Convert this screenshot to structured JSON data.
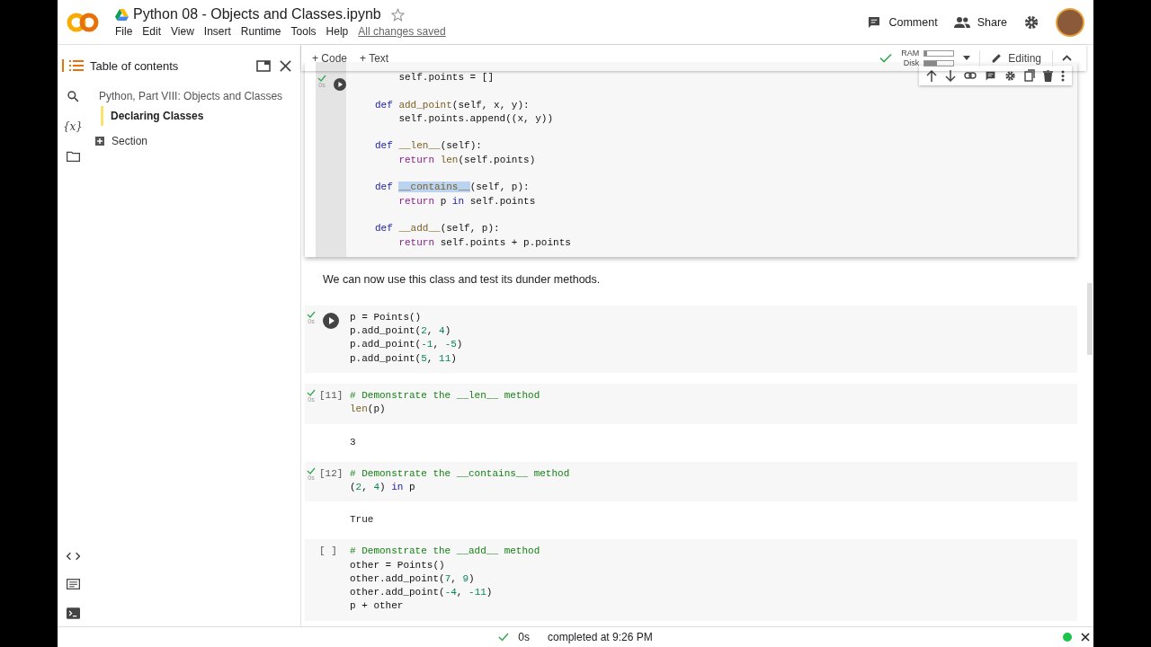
{
  "header": {
    "title": "Python 08 - Objects and Classes.ipynb",
    "menu": [
      "File",
      "Edit",
      "View",
      "Insert",
      "Runtime",
      "Tools",
      "Help"
    ],
    "save_status": "All changes saved",
    "comment": "Comment",
    "share": "Share"
  },
  "toolbar": {
    "add_code": "+ Code",
    "add_text": "+ Text",
    "connected": true,
    "resources": [
      {
        "label": "RAM",
        "level": 0.08
      },
      {
        "label": "Disk",
        "level": 0.42
      }
    ],
    "mode": "Editing"
  },
  "sidebar": {
    "rail_text": "{x}",
    "title": "Table of contents",
    "toc": [
      {
        "label": "Python, Part VIII: Objects and Classes",
        "selected": false,
        "children": [
          {
            "label": "Declaring Classes",
            "selected": true
          }
        ]
      }
    ],
    "add_section": "Section"
  },
  "cells": [
    {
      "kind": "code",
      "run_button": true,
      "done": true,
      "time": "0s",
      "focused": true,
      "lines": [
        {
          "kind": "code",
          "tokens": [
            {
              "text": "    self.points = []",
              "kind": "plain"
            }
          ]
        },
        {
          "kind": "blank"
        },
        {
          "kind": "code",
          "tokens": [
            {
              "text": "def ",
              "kind": "kw"
            },
            {
              "text": "add_point",
              "kind": "fn"
            },
            {
              "text": "(self, x, y):",
              "kind": "plain"
            }
          ]
        },
        {
          "kind": "code",
          "tokens": [
            {
              "text": "    self.points.append((x, y))",
              "kind": "plain"
            }
          ]
        },
        {
          "kind": "blank"
        },
        {
          "kind": "code",
          "tokens": [
            {
              "text": "def ",
              "kind": "kw"
            },
            {
              "text": "__len__",
              "kind": "fn"
            },
            {
              "text": "(self):",
              "kind": "plain"
            }
          ]
        },
        {
          "kind": "code",
          "tokens": [
            {
              "text": "    return ",
              "kind": "ctrl"
            },
            {
              "text": "len",
              "kind": "builtin"
            },
            {
              "text": "(self.points)",
              "kind": "plain"
            }
          ]
        },
        {
          "kind": "blank"
        },
        {
          "kind": "code",
          "tokens": [
            {
              "text": "def ",
              "kind": "kw"
            },
            {
              "text": "__contains__",
              "kind": "selection"
            },
            {
              "text": "(self, p):",
              "kind": "plain"
            }
          ]
        },
        {
          "kind": "code",
          "tokens": [
            {
              "text": "    return ",
              "kind": "ctrl"
            },
            {
              "text": "p ",
              "kind": "plain"
            },
            {
              "text": "in ",
              "kind": "kw"
            },
            {
              "text": "self.points",
              "kind": "plain"
            }
          ]
        },
        {
          "kind": "blank"
        },
        {
          "kind": "code",
          "tokens": [
            {
              "text": "def ",
              "kind": "kw"
            },
            {
              "text": "__add__",
              "kind": "fn"
            },
            {
              "text": "(self, p):",
              "kind": "plain"
            }
          ]
        },
        {
          "kind": "code",
          "tokens": [
            {
              "text": "    return ",
              "kind": "ctrl"
            },
            {
              "text": "self.points + p.points",
              "kind": "plain"
            }
          ]
        }
      ]
    },
    {
      "kind": "text",
      "text": "We can now use this class and test its dunder methods."
    },
    {
      "kind": "code",
      "run_button": true,
      "done": true,
      "time": "0s",
      "focused": false,
      "lines": [
        {
          "kind": "code",
          "tokens": [
            {
              "text": "p = Points()",
              "kind": "plain"
            }
          ]
        },
        {
          "kind": "code",
          "tokens": [
            {
              "text": "p.add_point(",
              "kind": "plain"
            },
            {
              "text": "2",
              "kind": "num"
            },
            {
              "text": ", ",
              "kind": "plain"
            },
            {
              "text": "4",
              "kind": "num"
            },
            {
              "text": ")",
              "kind": "plain"
            }
          ]
        },
        {
          "kind": "code",
          "tokens": [
            {
              "text": "p.add_point(",
              "kind": "plain"
            },
            {
              "text": "-1",
              "kind": "num"
            },
            {
              "text": ", ",
              "kind": "plain"
            },
            {
              "text": "-5",
              "kind": "num"
            },
            {
              "text": ")",
              "kind": "plain"
            }
          ]
        },
        {
          "kind": "code",
          "tokens": [
            {
              "text": "p.add_point(",
              "kind": "plain"
            },
            {
              "text": "5",
              "kind": "num"
            },
            {
              "text": ", ",
              "kind": "plain"
            },
            {
              "text": "11",
              "kind": "num"
            },
            {
              "text": ")",
              "kind": "plain"
            }
          ]
        }
      ]
    },
    {
      "kind": "code",
      "prompt": "[11]",
      "run_button": false,
      "done": true,
      "time": "0s",
      "focused": false,
      "lines": [
        {
          "kind": "code",
          "tokens": [
            {
              "text": "# Demonstrate the __len__ method",
              "kind": "comment"
            }
          ]
        },
        {
          "kind": "code",
          "tokens": [
            {
              "text": "len",
              "kind": "builtin"
            },
            {
              "text": "(p)",
              "kind": "plain"
            }
          ]
        }
      ],
      "output": "3"
    },
    {
      "kind": "code",
      "prompt": "[12]",
      "run_button": false,
      "done": true,
      "time": "0s",
      "focused": false,
      "lines": [
        {
          "kind": "code",
          "tokens": [
            {
              "text": "# Demonstrate the __contains__ method",
              "kind": "comment"
            }
          ]
        },
        {
          "kind": "code",
          "tokens": [
            {
              "text": "(",
              "kind": "plain"
            },
            {
              "text": "2",
              "kind": "num"
            },
            {
              "text": ", ",
              "kind": "plain"
            },
            {
              "text": "4",
              "kind": "num"
            },
            {
              "text": ") ",
              "kind": "plain"
            },
            {
              "text": "in ",
              "kind": "kw"
            },
            {
              "text": "p",
              "kind": "plain"
            }
          ]
        }
      ],
      "output": "True"
    },
    {
      "kind": "code",
      "prompt": "[ ]",
      "run_button": false,
      "done": false,
      "focused": false,
      "lines": [
        {
          "kind": "code",
          "tokens": [
            {
              "text": "# Demonstrate the __add__ method",
              "kind": "comment"
            }
          ]
        },
        {
          "kind": "code",
          "tokens": [
            {
              "text": "other = Points()",
              "kind": "plain"
            }
          ]
        },
        {
          "kind": "code",
          "tokens": [
            {
              "text": "other.add_point(",
              "kind": "plain"
            },
            {
              "text": "7",
              "kind": "num"
            },
            {
              "text": ", ",
              "kind": "plain"
            },
            {
              "text": "9",
              "kind": "num"
            },
            {
              "text": ")",
              "kind": "plain"
            }
          ]
        },
        {
          "kind": "code",
          "tokens": [
            {
              "text": "other.add_point(",
              "kind": "plain"
            },
            {
              "text": "-4",
              "kind": "num"
            },
            {
              "text": ", ",
              "kind": "plain"
            },
            {
              "text": "-11",
              "kind": "num"
            },
            {
              "text": ")",
              "kind": "plain"
            }
          ]
        },
        {
          "kind": "code",
          "tokens": [
            {
              "text": "p + other",
              "kind": "plain"
            }
          ]
        }
      ]
    }
  ],
  "status_bar": {
    "done": true,
    "time": "0s",
    "message": "completed at 9:26 PM",
    "connected": true
  }
}
